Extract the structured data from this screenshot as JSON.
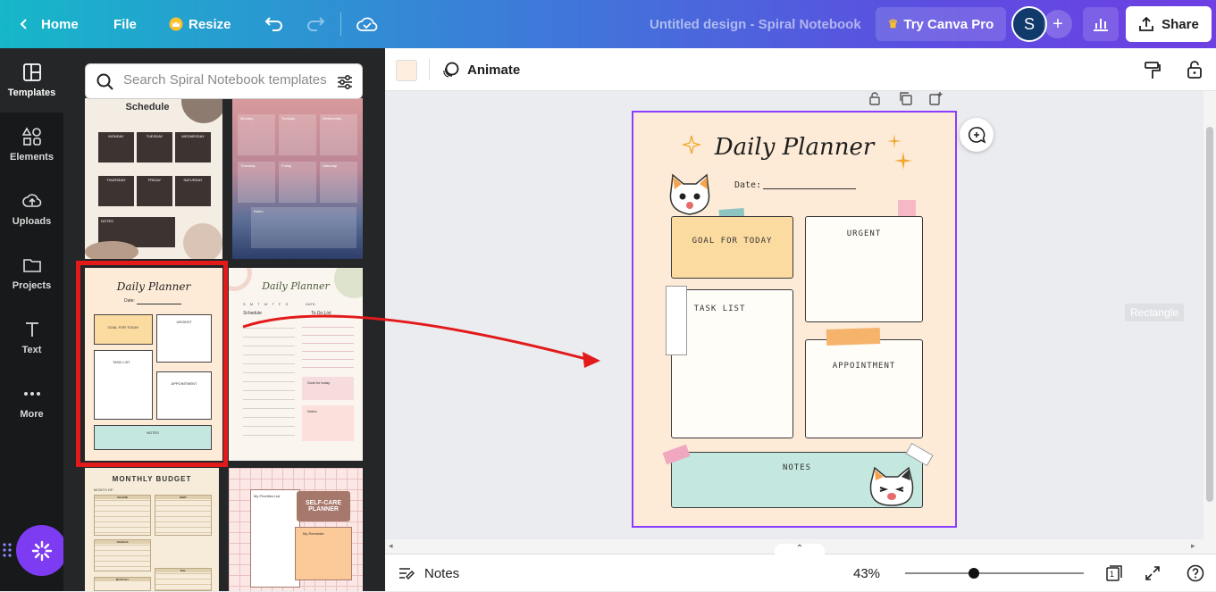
{
  "topbar": {
    "home_label": "Home",
    "file_label": "File",
    "resize_label": "Resize",
    "doc_title": "Untitled design - Spiral Notebook",
    "pro_label": "Try Canva Pro",
    "avatar_initial": "S",
    "share_label": "Share"
  },
  "rail": {
    "items": [
      {
        "label": "Templates",
        "icon": "templates-icon"
      },
      {
        "label": "Elements",
        "icon": "elements-icon"
      },
      {
        "label": "Uploads",
        "icon": "uploads-icon"
      },
      {
        "label": "Projects",
        "icon": "projects-icon"
      },
      {
        "label": "Text",
        "icon": "text-icon"
      },
      {
        "label": "More",
        "icon": "more-icon"
      }
    ]
  },
  "search": {
    "placeholder": "Search Spiral Notebook templates"
  },
  "templates": [
    {
      "title": "Schedule",
      "days": [
        "MONDAY",
        "TUESDAY",
        "WEDNESDAY",
        "THURSDAY",
        "FRIDAY",
        "SATURDAY"
      ],
      "notes": "NOTES"
    },
    {
      "days": [
        "Monday",
        "Tuesday",
        "Wednesday",
        "Thursday",
        "Friday",
        "Saturday"
      ],
      "notes": "Notes"
    },
    {
      "title": "Daily Planner",
      "date": "Date:",
      "boxes": [
        "GOAL FOR TODAY",
        "URGENT",
        "TASK LIST",
        "APPOINTMENT",
        "NOTES"
      ]
    },
    {
      "title": "Daily Planner",
      "weekdays": "S M T W T F S",
      "date": "DATE:",
      "schedule": "Schedule",
      "todo": "To Do List",
      "goal": "Goal for today",
      "notes": "Notes"
    },
    {
      "title": "MONTHLY BUDGET",
      "month": "MONTH OF:",
      "sections": [
        "INCOME",
        "DEBT",
        "SAVINGS",
        "BILL",
        "MONTHLY"
      ]
    },
    {
      "title": "SELF-CARE PLANNER",
      "list": "My Priorities List",
      "reminder": "My Reminder"
    }
  ],
  "context": {
    "animate_label": "Animate",
    "swatch_color": "#fdeee0"
  },
  "page": {
    "title": "Daily Planner",
    "date_label": "Date:",
    "goal": "GOAL FOR TODAY",
    "urgent": "URGENT",
    "task_list": "TASK LIST",
    "appointment": "APPOINTMENT",
    "notes": "NOTES"
  },
  "canvas": {
    "hover_label": "Rectangle"
  },
  "bottombar": {
    "notes_label": "Notes",
    "zoom": "43%",
    "zoom_level": 0.43,
    "page_count": "1"
  },
  "colors": {
    "accent": "#8b3dff",
    "annotation": "#e21a1a",
    "page_bg": "#fdebd8",
    "goal_box": "#fcdba0",
    "notes_box": "#c4e7e0"
  }
}
